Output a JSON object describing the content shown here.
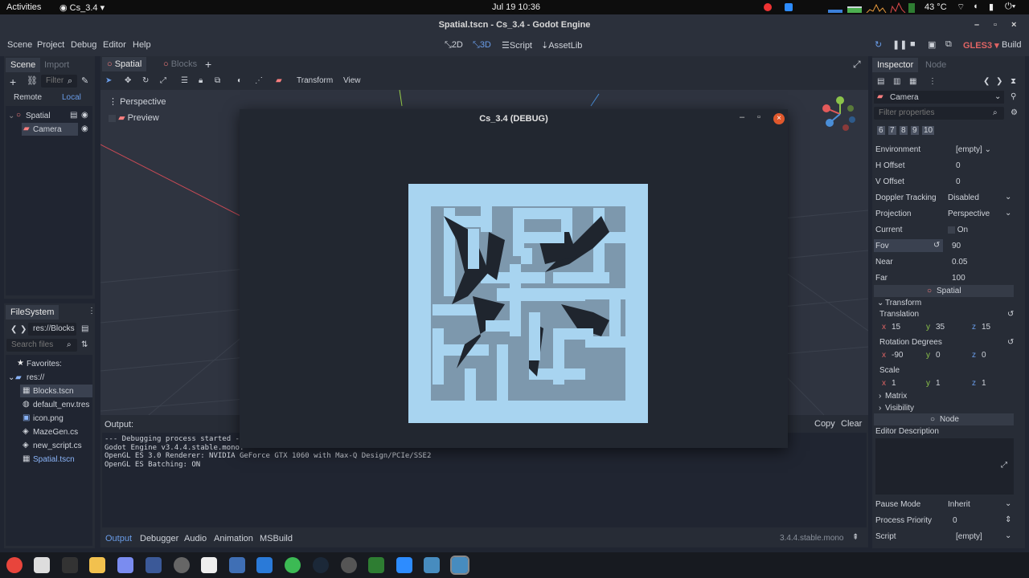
{
  "system": {
    "activities": "Activities",
    "app_menu": "Cs_3.4",
    "clock": "Jul 19  10:36",
    "temperature": "43 °C"
  },
  "window": {
    "title": "Spatial.tscn - Cs_3.4 - Godot Engine"
  },
  "menu": {
    "items": [
      "Scene",
      "Project",
      "Debug",
      "Editor",
      "Help"
    ]
  },
  "workspace": {
    "mode_2d": "2D",
    "mode_3d": "3D",
    "mode_script": "Script",
    "mode_assetlib": "AssetLib"
  },
  "right_toolbar": {
    "renderer": "GLES3",
    "build": "Build"
  },
  "scene_dock": {
    "tab_scene": "Scene",
    "tab_import": "Import",
    "filter_placeholder": "Filter",
    "remote": "Remote",
    "local": "Local",
    "nodes": [
      {
        "label": "Spatial"
      },
      {
        "label": "Camera"
      }
    ]
  },
  "editor_tabs": {
    "tab1": "Spatial",
    "tab2": "Blocks",
    "add": "+"
  },
  "viewport_toolbar": {
    "transform": "Transform",
    "view": "View"
  },
  "viewport": {
    "perspective": "Perspective",
    "preview": "Preview"
  },
  "debug_window": {
    "title": "Cs_3.4 (DEBUG)"
  },
  "filesystem": {
    "title": "FileSystem",
    "path": "res://Blocks",
    "search_placeholder": "Search files",
    "favorites": "Favorites:",
    "root": "res://",
    "files": [
      "Blocks.tscn",
      "default_env.tres",
      "icon.png",
      "MazeGen.cs",
      "new_script.cs",
      "Spatial.tscn"
    ]
  },
  "output": {
    "title": "Output:",
    "copy": "Copy",
    "clear": "Clear",
    "lines": [
      "--- Debugging process started ---",
      "Godot Engine v3.4.4.stable.mono.",
      "OpenGL ES 3.0 Renderer: NVIDIA GeForce GTX 1060 with Max-Q Design/PCIe/SSE2",
      "OpenGL ES Batching: ON"
    ]
  },
  "bottom_tabs": {
    "items": [
      "Output",
      "Debugger",
      "Audio",
      "Animation",
      "MSBuild"
    ],
    "version": "3.4.4.stable.mono"
  },
  "inspector": {
    "tab_inspector": "Inspector",
    "tab_node": "Node",
    "object": "Camera",
    "filter_placeholder": "Filter properties",
    "layers": [
      "6",
      "7",
      "8",
      "9",
      "10"
    ],
    "props": [
      {
        "label": "Environment",
        "value": "[empty]"
      },
      {
        "label": "H Offset",
        "value": "0"
      },
      {
        "label": "V Offset",
        "value": "0"
      },
      {
        "label": "Doppler Tracking",
        "value": "Disabled"
      },
      {
        "label": "Projection",
        "value": "Perspective"
      },
      {
        "label": "Current",
        "value": "On"
      },
      {
        "label": "Fov",
        "value": "90"
      },
      {
        "label": "Near",
        "value": "0.05"
      },
      {
        "label": "Far",
        "value": "100"
      }
    ],
    "section_spatial": "Spatial",
    "transform": "Transform",
    "translation": "Translation",
    "translation_vals": {
      "x": "15",
      "y": "35",
      "z": "15"
    },
    "rotation": "Rotation Degrees",
    "rotation_vals": {
      "x": "-90",
      "y": "0",
      "z": "0"
    },
    "scale": "Scale",
    "scale_vals": {
      "x": "1",
      "y": "1",
      "z": "1"
    },
    "axis": {
      "x": "x",
      "y": "y",
      "z": "z"
    },
    "matrix": "Matrix",
    "visibility": "Visibility",
    "section_node": "Node",
    "editor_description": "Editor Description",
    "pause_mode": {
      "label": "Pause Mode",
      "value": "Inherit"
    },
    "process_priority": {
      "label": "Process Priority",
      "value": "0"
    },
    "script": {
      "label": "Script",
      "value": "[empty]"
    }
  },
  "colors": {
    "accent": "#699ce8",
    "maze_light": "#a8d4f0",
    "maze_mid": "#7d98ad",
    "maze_dark": "#1f252e",
    "close_button": "#e0582c"
  }
}
